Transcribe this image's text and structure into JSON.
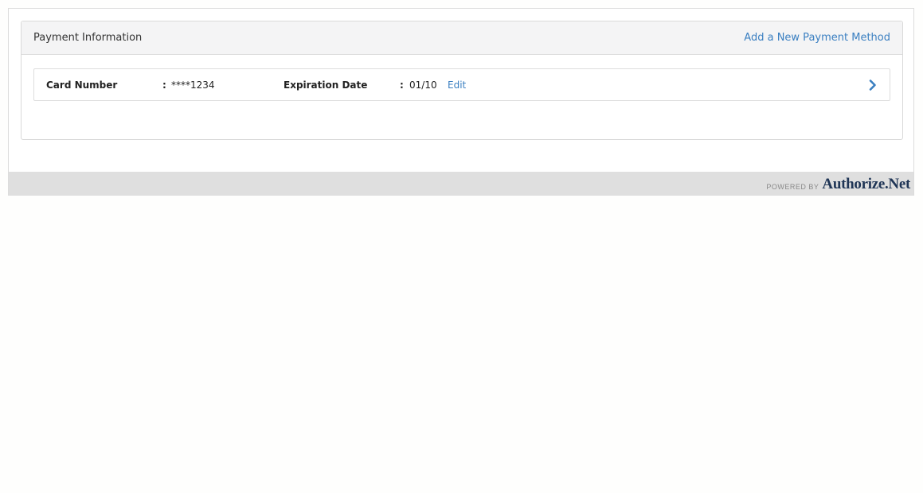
{
  "panel": {
    "title": "Payment Information",
    "add_link": "Add a New Payment Method"
  },
  "payment_method": {
    "card_number_label": "Card Number",
    "card_number_value": "****1234",
    "expiration_label": "Expiration Date",
    "expiration_value": "01/10",
    "colon": ":",
    "edit_label": "Edit",
    "chevron_icon": "chevron-right-icon"
  },
  "footer": {
    "powered_by": "POWERED BY",
    "logo": "Authorize.Net"
  },
  "colors": {
    "link": "#3a7fc1",
    "header_bg": "#f4f4f5",
    "footer_bg": "#dfdfdf",
    "logo": "#1f3556"
  }
}
